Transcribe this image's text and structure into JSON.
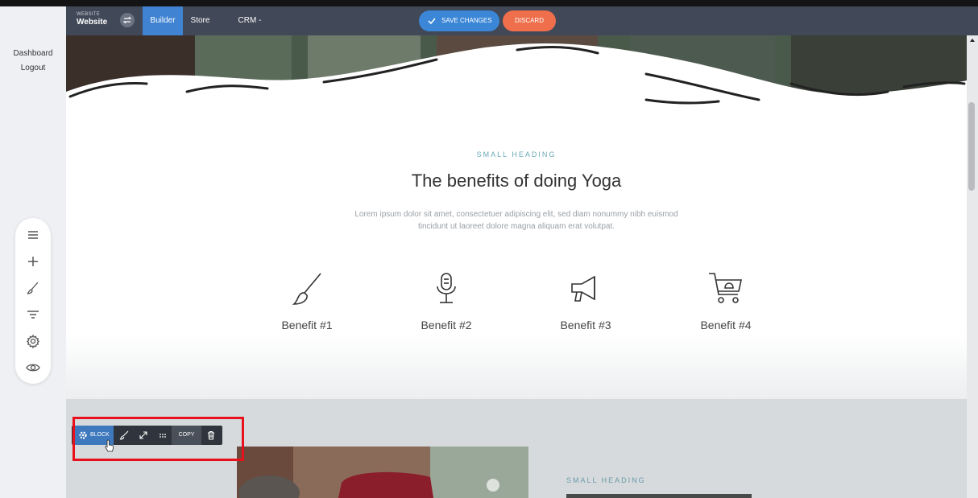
{
  "sidebar": {
    "links": [
      "Dashboard",
      "Logout"
    ],
    "tools": [
      "menu-icon",
      "plus-icon",
      "brush-icon",
      "filter-icon",
      "gear-icon",
      "eye-icon"
    ]
  },
  "topbar": {
    "brand_small": "WEBSITE",
    "brand_name": "Website",
    "tabs": [
      {
        "label": "Builder",
        "active": true
      },
      {
        "label": "Store",
        "active": false
      },
      {
        "label": "CRM - Engage",
        "active": false
      }
    ],
    "save_label": "SAVE CHANGES",
    "discard_label": "DISCARD"
  },
  "section": {
    "small_heading": "SMALL HEADING",
    "title": "The benefits of doing Yoga",
    "description": "Lorem ipsum dolor sit amet, consectetuer adipiscing elit, sed diam nonummy nibh euismod tincidunt ut laoreet dolore magna aliquam erat volutpat.",
    "benefits": [
      {
        "label": "Benefit #1",
        "icon": "brush-icon"
      },
      {
        "label": "Benefit #2",
        "icon": "microphone-icon"
      },
      {
        "label": "Benefit #3",
        "icon": "megaphone-icon"
      },
      {
        "label": "Benefit #4",
        "icon": "cart-icon"
      }
    ]
  },
  "section2": {
    "small_heading": "SMALL HEADING"
  },
  "block_toolbar": {
    "block_label": "BLOCK",
    "copy_label": "COPY"
  },
  "colors": {
    "topbar": "#414857",
    "active_tab": "#3f83d2",
    "save": "#3b86d6",
    "discard": "#ef6f4c",
    "highlight": "#e8101a",
    "accent_heading": "#6aa8b6"
  }
}
